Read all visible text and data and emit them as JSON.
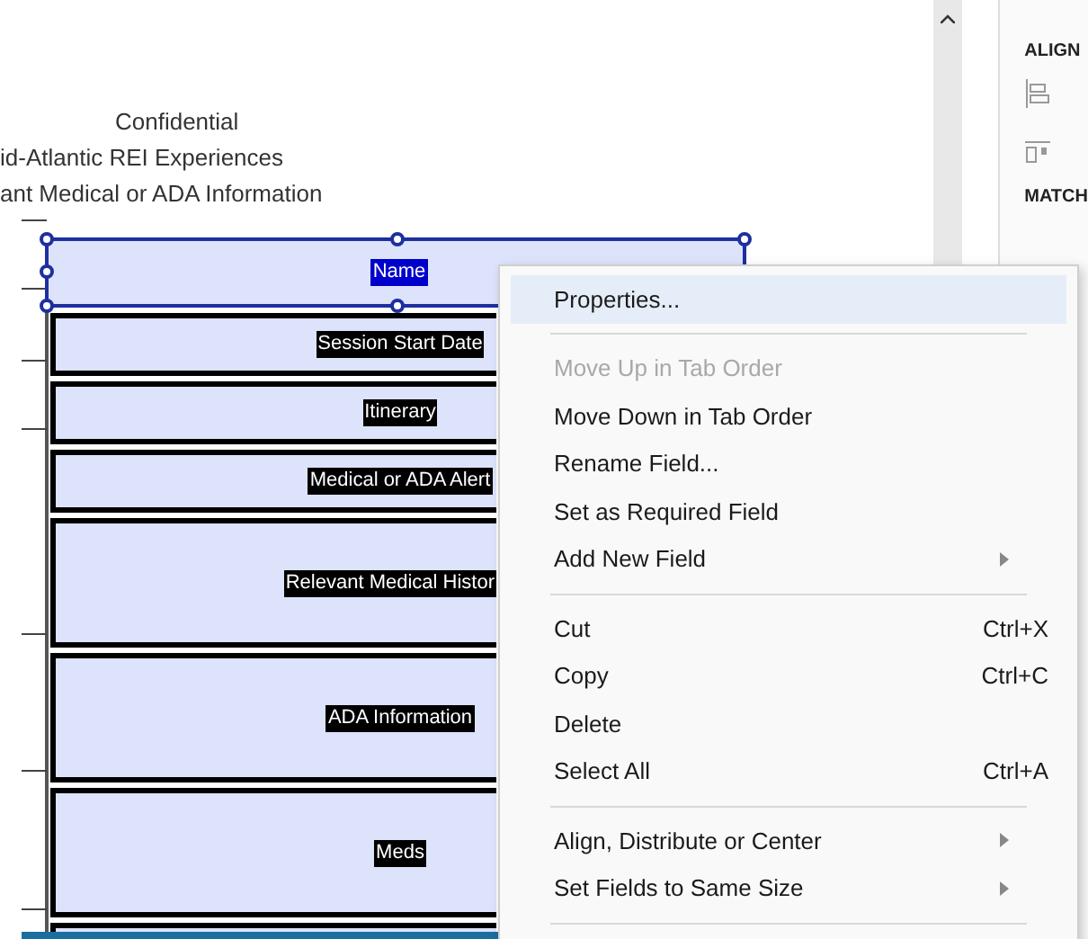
{
  "document": {
    "heading_lines": [
      "Confidential",
      "id-Atlantic REI Experiences",
      "ant Medical or ADA Information"
    ]
  },
  "form_fields": [
    {
      "label": "Name",
      "kind": "single_line",
      "selected": true
    },
    {
      "label": "Session Start Date",
      "kind": "single_line",
      "selected": false
    },
    {
      "label": "Itinerary",
      "kind": "single_line",
      "selected": false
    },
    {
      "label": "Medical or ADA Alert",
      "kind": "single_line",
      "selected": false
    },
    {
      "label": "Relevant Medical Histor",
      "kind": "multiline",
      "selected": false
    },
    {
      "label": "ADA Information",
      "kind": "multiline",
      "selected": false
    },
    {
      "label": "Meds",
      "kind": "multiline",
      "selected": false
    },
    {
      "kind": "multiline",
      "selected": false
    }
  ],
  "right_panel": {
    "sections": [
      "ALIGN",
      "MATCH"
    ]
  },
  "context_menu": {
    "items": [
      {
        "kind": "item",
        "label": "Properties...",
        "selected": true,
        "disabled": false,
        "submenu": false
      },
      {
        "kind": "separator"
      },
      {
        "kind": "item",
        "label": "Move Up in Tab Order",
        "selected": false,
        "disabled": true,
        "submenu": false
      },
      {
        "kind": "item",
        "label": "Move Down in Tab Order",
        "selected": false,
        "disabled": false,
        "submenu": false
      },
      {
        "kind": "item",
        "label": "Rename Field...",
        "selected": false,
        "disabled": false,
        "submenu": false
      },
      {
        "kind": "item",
        "label": "Set as Required Field",
        "selected": false,
        "disabled": false,
        "submenu": false
      },
      {
        "kind": "item",
        "label": "Add New Field",
        "selected": false,
        "disabled": false,
        "submenu": true
      },
      {
        "kind": "separator"
      },
      {
        "kind": "item",
        "label": "Cut",
        "shortcut": "Ctrl+X",
        "selected": false,
        "disabled": false,
        "submenu": false
      },
      {
        "kind": "item",
        "label": "Copy",
        "shortcut": "Ctrl+C",
        "selected": false,
        "disabled": false,
        "submenu": false
      },
      {
        "kind": "item",
        "label": "Delete",
        "selected": false,
        "disabled": false,
        "submenu": false
      },
      {
        "kind": "item",
        "label": "Select All",
        "shortcut": "Ctrl+A",
        "selected": false,
        "disabled": false,
        "submenu": false
      },
      {
        "kind": "separator"
      },
      {
        "kind": "item",
        "label": "Align, Distribute or Center",
        "selected": false,
        "disabled": false,
        "submenu": true
      },
      {
        "kind": "item",
        "label": "Set Fields to Same Size",
        "selected": false,
        "disabled": false,
        "submenu": true
      },
      {
        "kind": "separator"
      }
    ]
  }
}
